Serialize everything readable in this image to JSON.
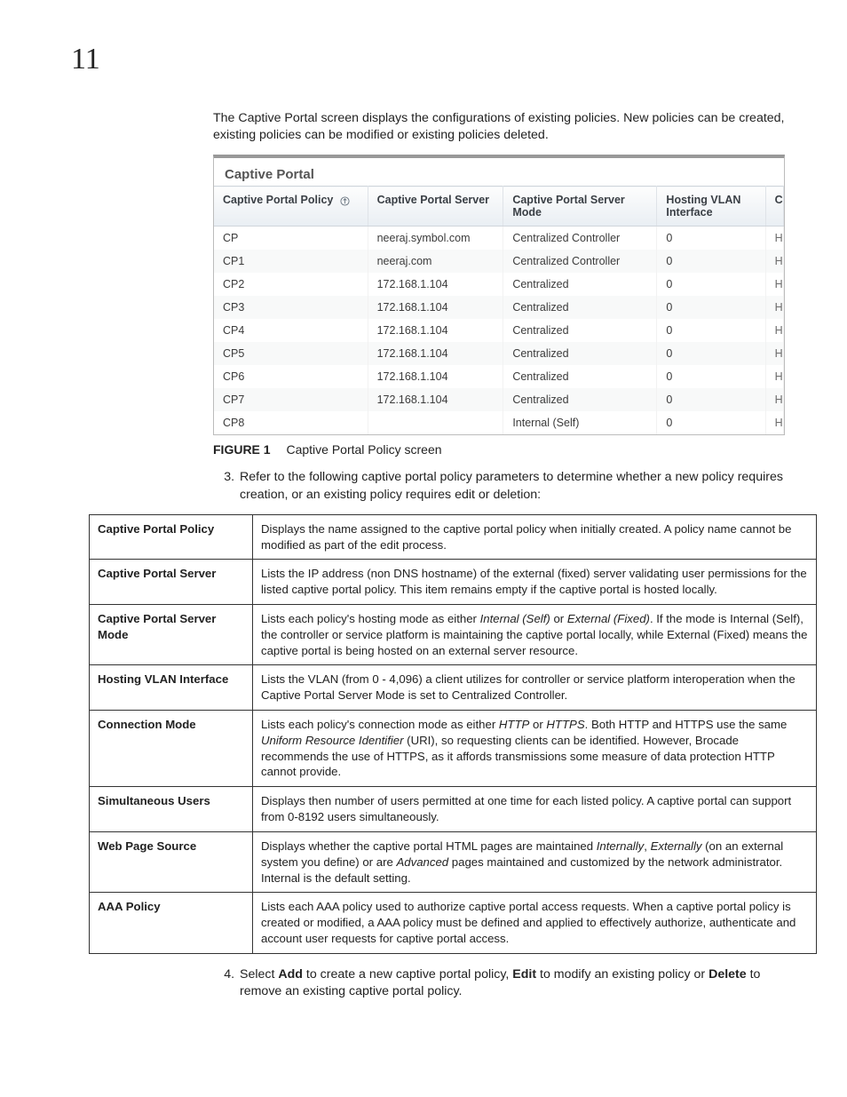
{
  "chapter_number": "11",
  "intro": "The Captive Portal screen displays the configurations of existing policies. New policies can be created, existing policies can be modified or existing policies deleted.",
  "fig": {
    "panel_title": "Captive Portal",
    "headers": {
      "c0": "Captive Portal Policy",
      "c1": "Captive Portal Server",
      "c2": "Captive Portal Server Mode",
      "c3": "Hosting VLAN Interface",
      "c4": "C"
    },
    "rows": [
      {
        "c0": "CP",
        "c1": "neeraj.symbol.com",
        "c2": "Centralized Controller",
        "c3": "0",
        "c4": "H"
      },
      {
        "c0": "CP1",
        "c1": "neeraj.com",
        "c2": "Centralized Controller",
        "c3": "0",
        "c4": "H"
      },
      {
        "c0": "CP2",
        "c1": "172.168.1.104",
        "c2": "Centralized",
        "c3": "0",
        "c4": "H"
      },
      {
        "c0": "CP3",
        "c1": "172.168.1.104",
        "c2": "Centralized",
        "c3": "0",
        "c4": "H"
      },
      {
        "c0": "CP4",
        "c1": "172.168.1.104",
        "c2": "Centralized",
        "c3": "0",
        "c4": "H"
      },
      {
        "c0": "CP5",
        "c1": "172.168.1.104",
        "c2": "Centralized",
        "c3": "0",
        "c4": "H"
      },
      {
        "c0": "CP6",
        "c1": "172.168.1.104",
        "c2": "Centralized",
        "c3": "0",
        "c4": "H"
      },
      {
        "c0": "CP7",
        "c1": "172.168.1.104",
        "c2": "Centralized",
        "c3": "0",
        "c4": "H"
      },
      {
        "c0": "CP8",
        "c1": "",
        "c2": "Internal (Self)",
        "c3": "0",
        "c4": "H"
      }
    ],
    "caption_label": "FIGURE 1",
    "caption_text": "Captive Portal Policy screen"
  },
  "step3": "Refer to the following captive portal policy parameters to determine whether a new policy requires creation, or an existing policy requires edit or deletion:",
  "defs": [
    {
      "k": "Captive Portal Policy",
      "v": "Displays the name assigned to the captive portal policy when initially created. A policy name cannot be modified as part of the edit process."
    },
    {
      "k": "Captive Portal Server",
      "v": "Lists the IP address (non DNS hostname) of the external (fixed) server validating user permissions for the listed captive portal policy. This item remains empty if the captive portal is hosted locally."
    },
    {
      "k": "Captive Portal Server Mode",
      "v": "Lists each policy's hosting mode as either <em>Internal (Self)</em> or <em>External (Fixed)</em>. If the mode is Internal (Self), the controller or service platform is maintaining the captive portal locally, while External (Fixed) means the captive portal is being hosted on an external server resource."
    },
    {
      "k": "Hosting VLAN Interface",
      "v": "Lists the VLAN (from 0 - 4,096) a client utilizes for controller or service platform interoperation when the Captive Portal Server Mode is set to Centralized Controller."
    },
    {
      "k": "Connection Mode",
      "v": "Lists each policy's connection mode as either <em>HTTP</em> or <em>HTTPS</em>. Both HTTP and HTTPS use the same <em>Uniform Resource Identifier</em> (URI), so requesting clients can be identified. However, Brocade recommends the use of HTTPS, as it affords transmissions some measure of data protection HTTP cannot provide."
    },
    {
      "k": "Simultaneous Users",
      "v": "Displays then number of users permitted at one time for each listed policy. A captive portal can support from 0-8192 users simultaneously."
    },
    {
      "k": "Web Page Source",
      "v": "Displays whether the captive portal HTML pages are maintained <em>Internally</em>, <em>Externally</em> (on an external system you define) or are <em>Advanced</em> pages maintained and customized by the network administrator. Internal is the default setting."
    },
    {
      "k": "AAA Policy",
      "v": "Lists each AAA policy used to authorize captive portal access requests. When a captive portal policy is created or modified, a AAA policy must be defined and applied to effectively authorize, authenticate and account user requests for captive portal access."
    }
  ],
  "step4": {
    "pre": "Select ",
    "add": "Add",
    "mid1": " to create a new captive portal policy, ",
    "edit": "Edit",
    "mid2": " to modify an existing policy or ",
    "del": "Delete",
    "post": " to remove an existing captive portal policy."
  }
}
